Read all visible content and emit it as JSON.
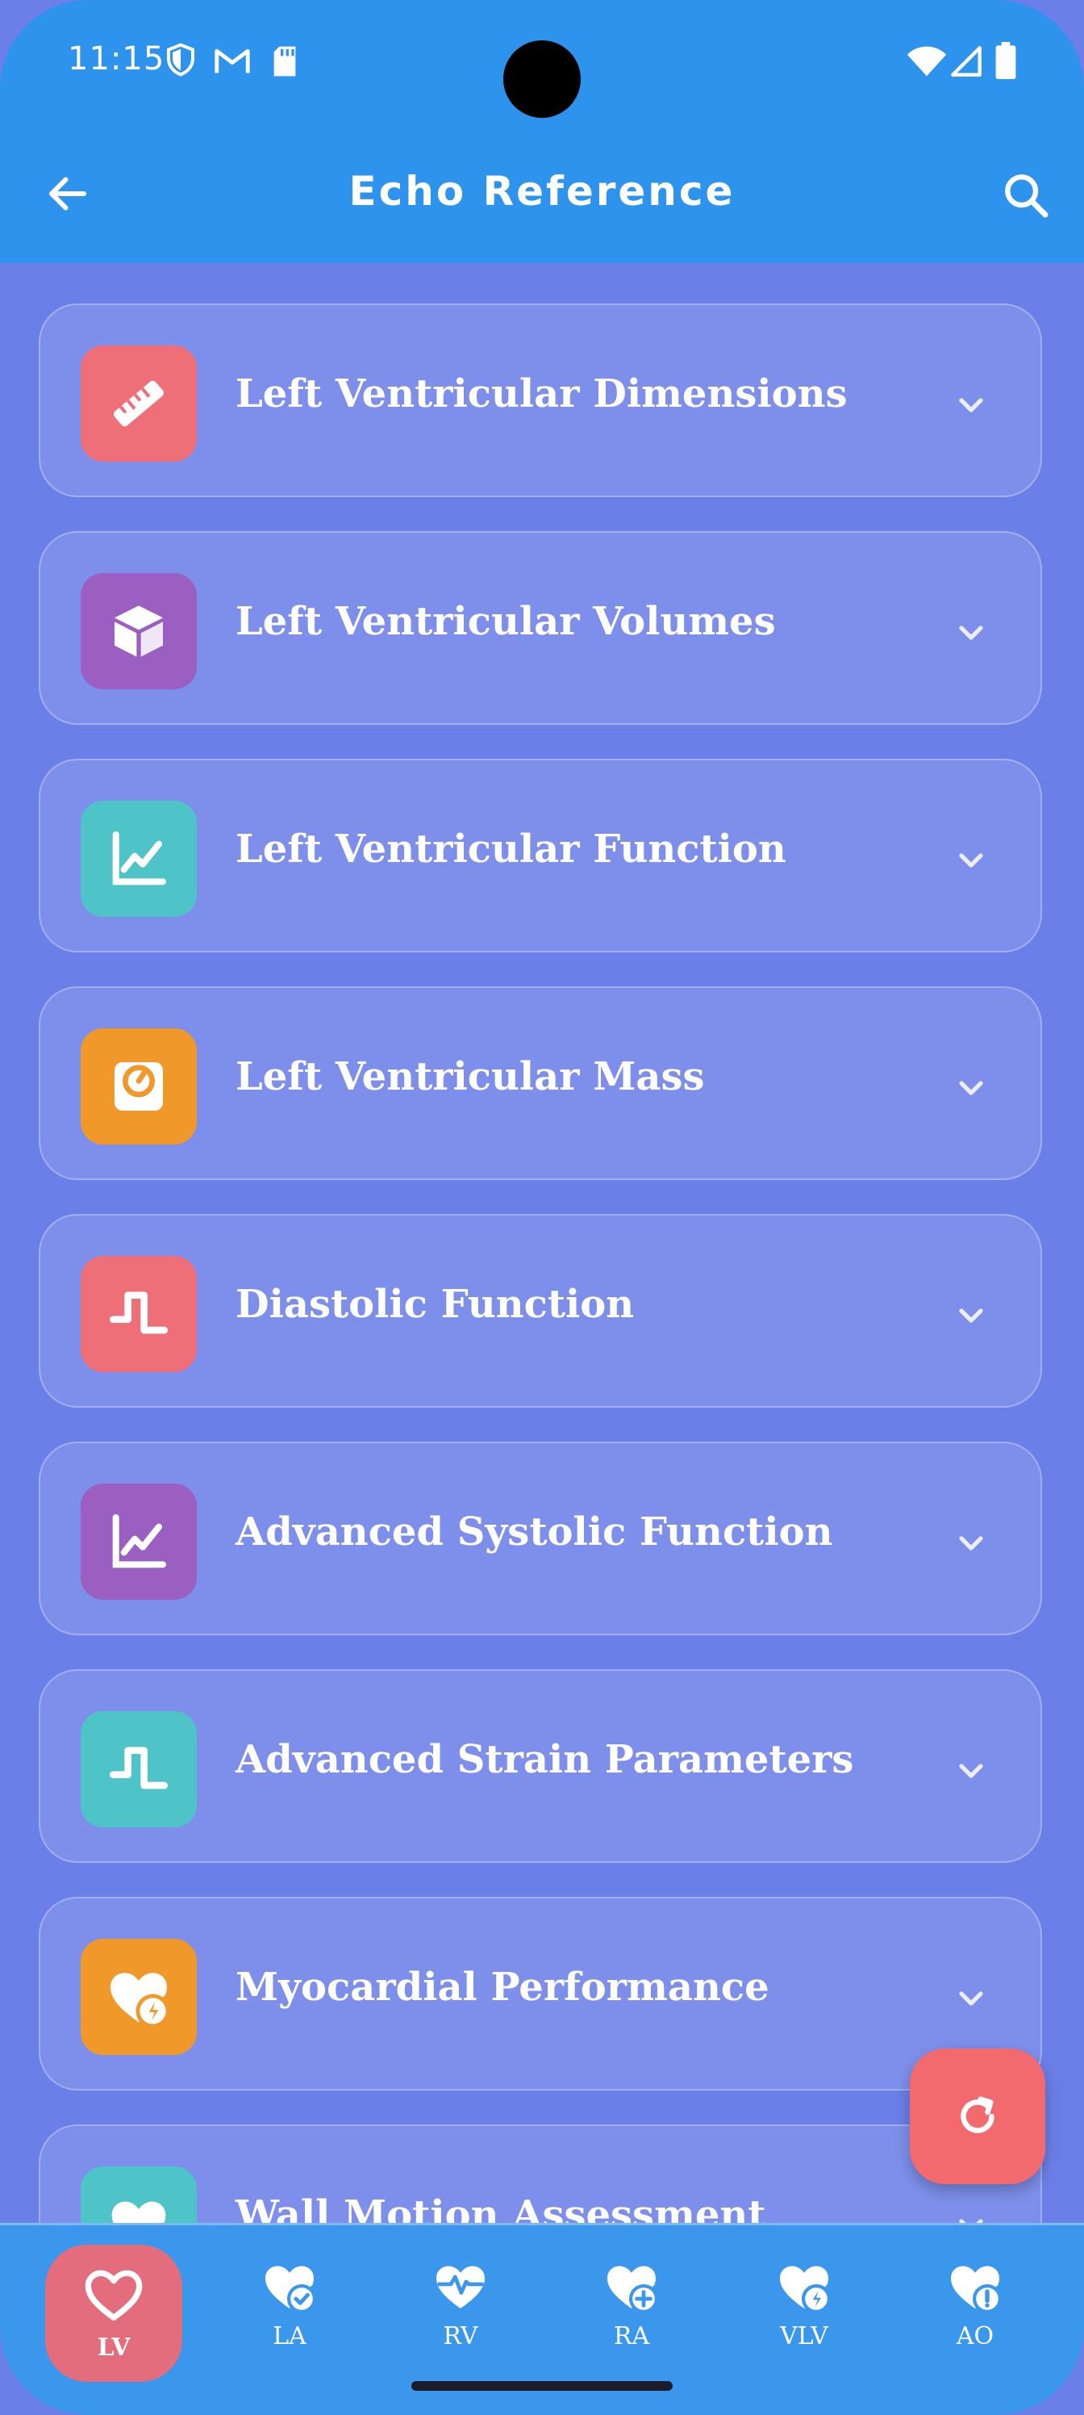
{
  "status_bar": {
    "time": "11:15"
  },
  "app_bar": {
    "title": "Echo Reference"
  },
  "colors": {
    "header": "#2d93ec",
    "background": "#6b7fe8",
    "red": "#ef6f79",
    "purple": "#9a5fc0",
    "teal": "#4fc4c8",
    "orange": "#f0992a"
  },
  "sections": [
    {
      "label": "Left Ventricular Dimensions",
      "icon": "ruler-icon",
      "color": "#ef6f79"
    },
    {
      "label": "Left Ventricular Volumes",
      "icon": "cube-icon",
      "color": "#9a5fc0"
    },
    {
      "label": "Left Ventricular Function",
      "icon": "line-chart-icon",
      "color": "#4fc4c8"
    },
    {
      "label": "Left Ventricular Mass",
      "icon": "scale-icon",
      "color": "#f0992a"
    },
    {
      "label": "Diastolic Function",
      "icon": "wave-icon",
      "color": "#ef6f79"
    },
    {
      "label": "Advanced Systolic Function",
      "icon": "line-chart-icon",
      "color": "#9a5fc0"
    },
    {
      "label": "Advanced Strain Parameters",
      "icon": "wave-icon",
      "color": "#4fc4c8"
    },
    {
      "label": "Myocardial Performance",
      "icon": "heart-bolt-icon",
      "color": "#f0992a"
    },
    {
      "label": "Wall Motion Assessment",
      "icon": "heart-icon",
      "color": "#4fc4c8"
    }
  ],
  "bottom_nav": [
    {
      "label": "LV",
      "icon": "heart-outline-icon",
      "active": true
    },
    {
      "label": "LA",
      "icon": "heart-check-icon",
      "active": false
    },
    {
      "label": "RV",
      "icon": "heart-pulse-icon",
      "active": false
    },
    {
      "label": "RA",
      "icon": "heart-plus-icon",
      "active": false
    },
    {
      "label": "VLV",
      "icon": "heart-bolt-icon",
      "active": false
    },
    {
      "label": "AO",
      "icon": "heart-alert-icon",
      "active": false
    }
  ],
  "fab": {
    "icon": "refresh-icon"
  }
}
